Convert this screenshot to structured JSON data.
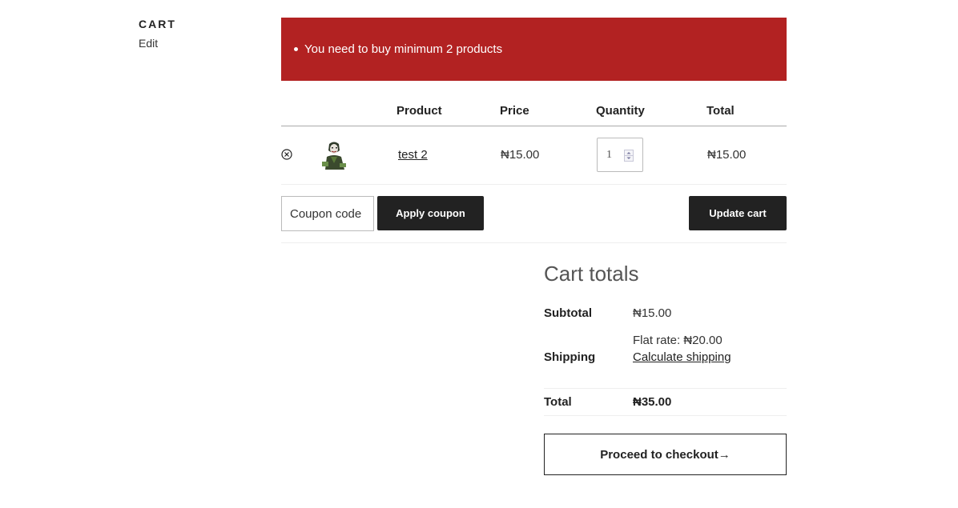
{
  "sidebar": {
    "title": "CART",
    "edit_label": "Edit"
  },
  "notice": {
    "message": "You need to buy minimum 2 products",
    "color": "#b22222"
  },
  "table": {
    "headers": {
      "product": "Product",
      "price": "Price",
      "quantity": "Quantity",
      "total": "Total"
    },
    "rows": [
      {
        "name": "test 2",
        "price": "₦15.00",
        "quantity": "1",
        "total": "₦15.00"
      }
    ]
  },
  "actions": {
    "coupon_placeholder": "Coupon code",
    "apply_coupon_label": "Apply coupon",
    "update_cart_label": "Update cart"
  },
  "totals": {
    "title": "Cart totals",
    "subtotal_label": "Subtotal",
    "subtotal_value": "₦15.00",
    "shipping_label": "Shipping",
    "shipping_rate": "Flat rate: ₦20.00",
    "calculate_shipping": "Calculate shipping",
    "total_label": "Total",
    "total_value": "₦35.00",
    "checkout_label": "Proceed to checkout→"
  }
}
